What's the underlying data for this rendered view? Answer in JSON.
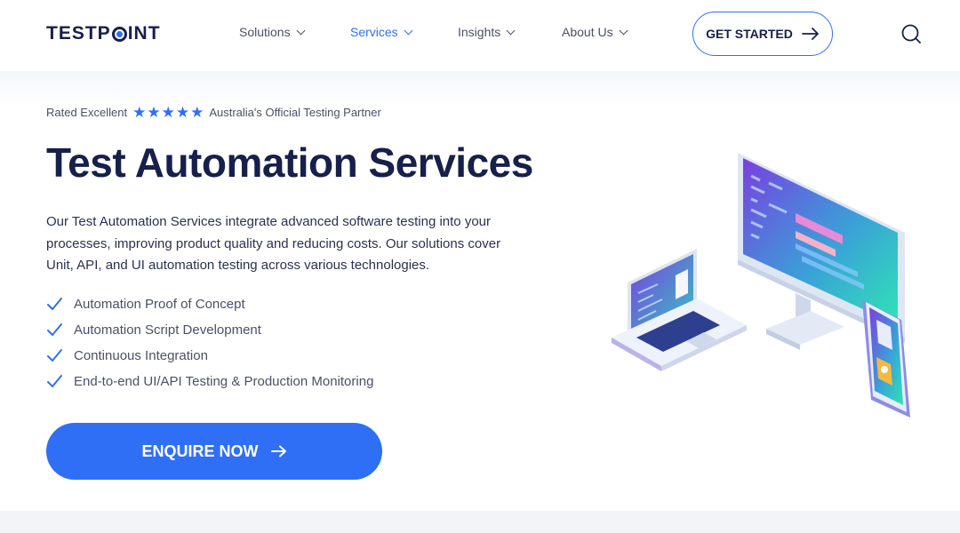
{
  "brand": {
    "logo_prefix": "TESTP",
    "logo_suffix": "INT"
  },
  "nav": {
    "items": [
      {
        "label": "Solutions",
        "active": false
      },
      {
        "label": "Services",
        "active": true
      },
      {
        "label": "Insights",
        "active": false
      },
      {
        "label": "About Us",
        "active": false
      }
    ],
    "cta_label": "GET STARTED"
  },
  "hero": {
    "rating_prefix": "Rated Excellent",
    "stars": 5,
    "rating_suffix": "Australia's Official Testing Partner",
    "title": "Test Automation Services",
    "description": "Our Test Automation Services integrate advanced software testing into your processes, improving product quality and reducing costs. Our solutions cover Unit, API, and UI automation testing across various technologies.",
    "features": [
      "Automation Proof of Concept",
      "Automation Script Development",
      "Continuous Integration",
      "End-to-end UI/API Testing & Production Monitoring"
    ],
    "button_label": "ENQUIRE NOW"
  },
  "icons": {
    "search": "search-icon",
    "arrow": "arrow-right-icon",
    "check": "check-icon",
    "star": "star-icon",
    "chevron": "chevron-down-icon"
  },
  "colors": {
    "accent": "#2f6ff5",
    "heading": "#16204a",
    "body_text": "#4a5068"
  }
}
